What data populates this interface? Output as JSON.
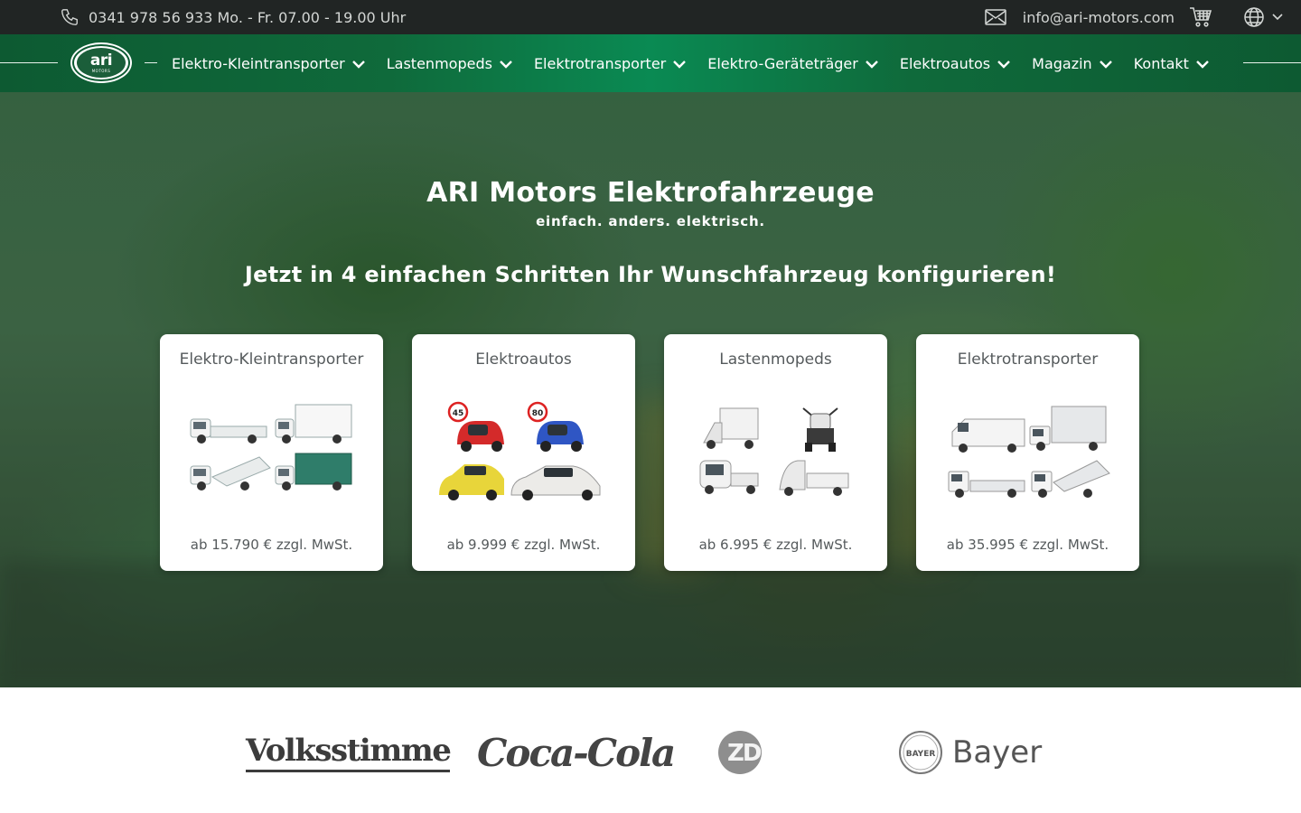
{
  "topbar": {
    "phone_text": "0341 978 56 933 Mo. - Fr. 07.00 - 19.00 Uhr",
    "email": "info@ari-motors.com"
  },
  "logo": {
    "word": "ari",
    "sub": "MOTORS"
  },
  "nav": {
    "items": [
      {
        "label": "Elektro-Kleintransporter"
      },
      {
        "label": "Lastenmopeds"
      },
      {
        "label": "Elektrotransporter"
      },
      {
        "label": "Elektro-Geräteträger"
      },
      {
        "label": "Elektroautos"
      },
      {
        "label": "Magazin"
      },
      {
        "label": "Kontakt"
      }
    ]
  },
  "hero": {
    "title": "ARI Motors Elektrofahrzeuge",
    "subtitle": "einfach. anders. elektrisch.",
    "cta": "Jetzt in 4 einfachen Schritten Ihr Wunschfahrzeug konfigurieren!"
  },
  "cards": [
    {
      "title": "Elektro-Kleintransporter",
      "price": "ab 15.790 € zzgl. MwSt."
    },
    {
      "title": "Elektroautos",
      "price": "ab 9.999 € zzgl. MwSt.",
      "badge1": "45",
      "badge2": "80"
    },
    {
      "title": "Lastenmopeds",
      "price": "ab 6.995 € zzgl. MwSt."
    },
    {
      "title": "Elektrotransporter",
      "price": "ab 35.995 € zzgl. MwSt."
    }
  ],
  "brands": {
    "volksstimme": "Volksstimme",
    "cocacola": "Coca-Cola",
    "zdf": "ZDF",
    "bayer": "Bayer",
    "bayer_cross": "BAYER"
  },
  "colors": {
    "topbar_bg": "#212524",
    "nav_green": "#0f6a3b",
    "card_text": "#555a5c"
  }
}
